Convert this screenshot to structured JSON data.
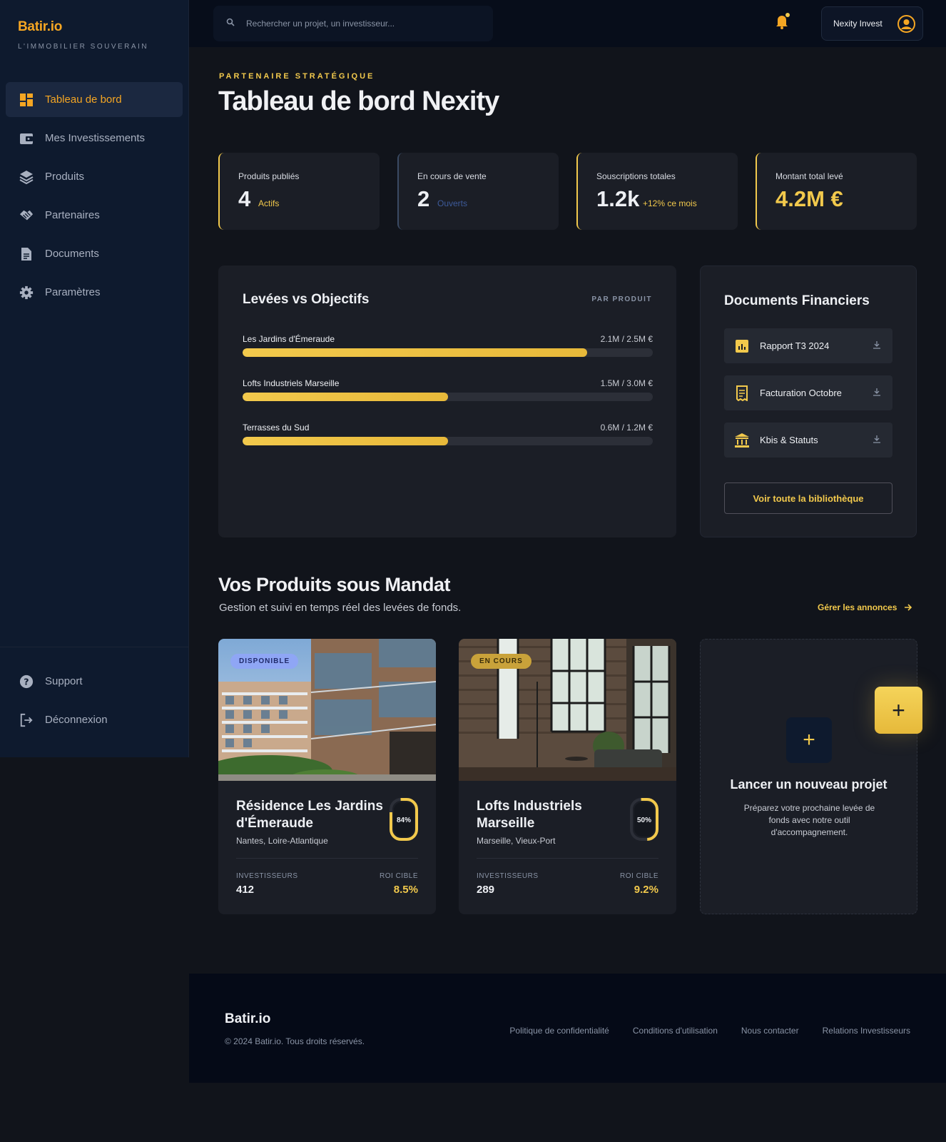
{
  "brand": {
    "name": "Batir.io",
    "tagline": "L'IMMOBILIER SOUVERAIN"
  },
  "sidebar": {
    "items": [
      {
        "label": "Tableau de bord",
        "icon": "dashboard-icon",
        "active": true
      },
      {
        "label": "Mes Investissements",
        "icon": "wallet-icon"
      },
      {
        "label": "Produits",
        "icon": "layers-icon"
      },
      {
        "label": "Partenaires",
        "icon": "handshake-icon"
      },
      {
        "label": "Documents",
        "icon": "document-icon"
      },
      {
        "label": "Paramètres",
        "icon": "gear-icon"
      }
    ],
    "bottom": [
      {
        "label": "Support",
        "icon": "help-icon"
      },
      {
        "label": "Déconnexion",
        "icon": "logout-icon"
      }
    ]
  },
  "header": {
    "search_placeholder": "Rechercher un projet, un investisseur...",
    "user_name": "Nexity Invest"
  },
  "page": {
    "eyebrow": "PARTENAIRE STRATÉGIQUE",
    "title": "Tableau de bord Nexity"
  },
  "kpis": [
    {
      "label": "Produits publiés",
      "value": "4",
      "sub": "Actifs"
    },
    {
      "label": "En cours de vente",
      "value": "2",
      "sub": "Ouverts"
    },
    {
      "label": "Souscriptions totales",
      "value": "1.2k",
      "sub": "+12% ce mois"
    },
    {
      "label": "Montant total levé",
      "value": "4.2M €",
      "sub": ""
    }
  ],
  "levees": {
    "title": "Levées vs Objectifs",
    "tag": "PAR PRODUIT",
    "rows": [
      {
        "name": "Les Jardins d'Émeraude",
        "amount": "2.1M / 2.5M €",
        "progress": 0.84
      },
      {
        "name": "Lofts Industriels Marseille",
        "amount": "1.5M / 3.0M €",
        "progress": 0.5
      },
      {
        "name": "Terrasses du Sud",
        "amount": "0.6M / 1.2M €",
        "progress": 0.5
      }
    ]
  },
  "documents": {
    "title": "Documents Financiers",
    "items": [
      {
        "label": "Rapport T3 2024",
        "icon": "chart-report-icon"
      },
      {
        "label": "Facturation Octobre",
        "icon": "receipt-icon"
      },
      {
        "label": "Kbis & Statuts",
        "icon": "bank-icon"
      }
    ],
    "library_button": "Voir toute la bibliothèque"
  },
  "products": {
    "title": "Vos Produits sous Mandat",
    "subtitle": "Gestion et suivi en temps réel des levées de fonds.",
    "manage_link": "Gérer les annonces",
    "cards": [
      {
        "badge": "DISPONIBLE",
        "name": "Résidence Les Jardins d'Émeraude",
        "location": "Nantes, Loire-Atlantique",
        "progress_label": "84%",
        "progress": 0.84,
        "investors_label": "INVESTISSEURS",
        "investors": "412",
        "roi_label": "ROI CIBLE",
        "roi": "8.5%"
      },
      {
        "badge": "EN COURS",
        "name": "Lofts Industriels Marseille",
        "location": "Marseille, Vieux-Port",
        "progress_label": "50%",
        "progress": 0.5,
        "investors_label": "INVESTISSEURS",
        "investors": "289",
        "roi_label": "ROI CIBLE",
        "roi": "9.2%"
      }
    ],
    "new_project": {
      "title": "Lancer un nouveau projet",
      "description": "Préparez votre prochaine levée de fonds avec notre outil d'accompagnement."
    }
  },
  "footer": {
    "brand": "Batir.io",
    "copyright": "© 2024 Batir.io. Tous droits réservés.",
    "links": [
      "Politique de confidentialité",
      "Conditions d'utilisation",
      "Nous contacter",
      "Relations Investisseurs"
    ]
  },
  "colors": {
    "accent": "#f2c94c",
    "brand_orange": "#f5a623",
    "sidebar_bg": "#0e1a2e",
    "panel_bg": "#1b1e26"
  }
}
